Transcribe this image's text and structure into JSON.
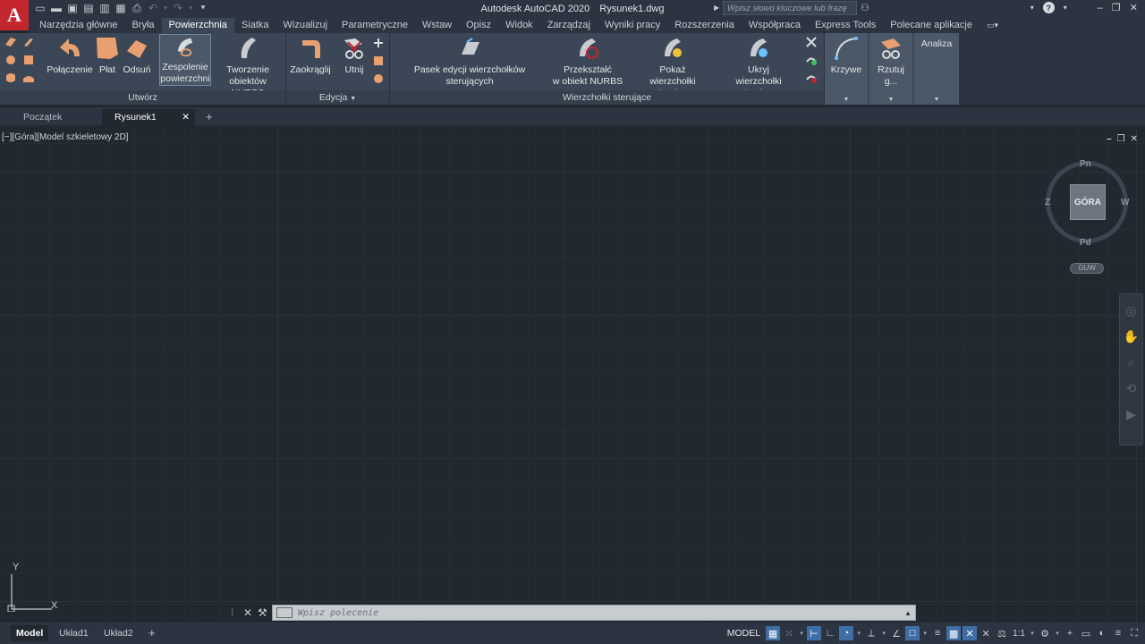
{
  "app": {
    "logo_letter": "A",
    "title": "Autodesk AutoCAD 2020",
    "filename": "Rysunek1.dwg",
    "search_placeholder": "Wpisz słowo kluczowe lub frazę"
  },
  "menu": {
    "tabs": [
      "Narzędzia główne",
      "Bryła",
      "Powierzchnia",
      "Siatka",
      "Wizualizuj",
      "Parametryczne",
      "Wstaw",
      "Opisz",
      "Widok",
      "Zarządzaj",
      "Wyniki pracy",
      "Rozszerzenia",
      "Współpraca",
      "Express Tools",
      "Polecane aplikacje"
    ],
    "active_index": 2
  },
  "ribbon": {
    "panels": {
      "create": "Utwórz",
      "edit": "Edycja",
      "control_vertices": "Wierzchołki sterujące"
    },
    "buttons": {
      "connection": "Połączenie",
      "patch": "Płat",
      "offset": "Odsuń",
      "blend_line1": "Zespolenie",
      "blend_line2": "powierzchni",
      "nurbs_line1": "Tworzenie",
      "nurbs_line2": "obiektów NURBS",
      "fillet": "Zaokrąglij",
      "trim": "Utnij",
      "cv_bar": "Pasek edycji wierzchołków sterujących",
      "convert_line1": "Przekształć",
      "convert_line2": "w obiekt NURBS",
      "show_cv_line1": "Pokaż",
      "show_cv_line2": "wierzchołki sterujące",
      "hide_cv_line1": "Ukryj",
      "hide_cv_line2": "wierzchołki sterujące",
      "curves": "Krzywe",
      "project": "Rzutuj g...",
      "analysis": "Analiza"
    }
  },
  "doc_tabs": {
    "start": "Początek",
    "drawing": "Rysunek1"
  },
  "viewport": {
    "label": "[−][Góra][Model szkieletowy 2D]"
  },
  "viewcube": {
    "face": "GÓRA",
    "north": "Pn",
    "south": "Pd",
    "east": "W",
    "west": "Z",
    "ucs_menu": "GUW"
  },
  "ucs_icon": {
    "x_label": "X",
    "y_label": "Y"
  },
  "command": {
    "placeholder": "Wpisz polecenie"
  },
  "status": {
    "layout_tabs": [
      "Model",
      "Układ1",
      "Układ2"
    ],
    "model_label": "MODEL",
    "scale": "1:1"
  },
  "colors": {
    "accent_orange": "#e8a070",
    "ribbon_bg": "#3b4756",
    "canvas_bg": "#212830",
    "active_toggle": "#3f6ea6"
  }
}
